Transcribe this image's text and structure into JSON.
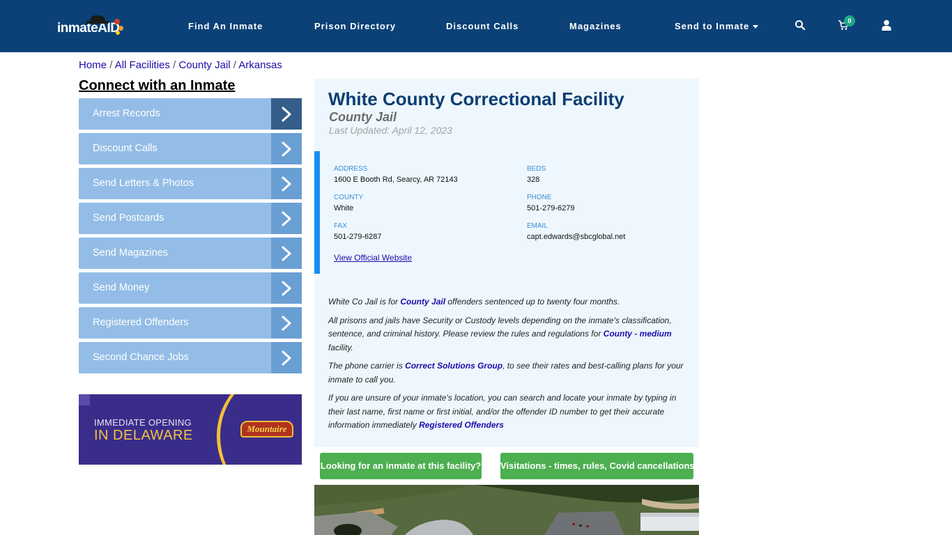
{
  "navbar": {
    "logo_text": "inmateAID",
    "items": [
      {
        "label": "Find An Inmate"
      },
      {
        "label": "Prison Directory"
      },
      {
        "label": "Discount Calls"
      },
      {
        "label": "Magazines"
      },
      {
        "label": "Send to Inmate",
        "has_dropdown": true
      }
    ],
    "icons": [
      "search-icon",
      "cart-icon",
      "user-icon"
    ],
    "cart_count": "0",
    "bg_color": "#0b4177"
  },
  "breadcrumb": [
    {
      "label": "Home"
    },
    {
      "label": "All Facilities"
    },
    {
      "label": "County Jail"
    },
    {
      "label": "Arkansas"
    }
  ],
  "breadcrumb_separator": "/",
  "sidebar": {
    "title": "Connect with an Inmate",
    "items": [
      {
        "label": "Arrest Records",
        "active": true
      },
      {
        "label": "Discount Calls"
      },
      {
        "label": "Send Letters & Photos"
      },
      {
        "label": "Send Postcards"
      },
      {
        "label": "Send Magazines"
      },
      {
        "label": "Send Money"
      },
      {
        "label": "Registered Offenders"
      },
      {
        "label": "Second Chance Jobs"
      }
    ]
  },
  "ad": {
    "line1": "IMMEDIATE OPENING",
    "line2": "IN DELAWARE",
    "brand": "Mountaire"
  },
  "facility": {
    "name": "White County Correctional Facility",
    "type": "County Jail",
    "last_updated": "Last Updated: April 12, 2023",
    "fields": {
      "address": {
        "label": "ADDRESS",
        "value": "1600 E Booth Rd, Searcy, AR 72143"
      },
      "beds": {
        "label": "BEDS",
        "value": "328"
      },
      "county": {
        "label": "COUNTY",
        "value": "White"
      },
      "phone": {
        "label": "PHONE",
        "value": "501-279-6279"
      },
      "fax": {
        "label": "FAX",
        "value": "501-279-6287"
      },
      "email": {
        "label": "EMAIL",
        "value": "capt.edwards@sbcglobal.net"
      }
    },
    "website_link": "View Official Website"
  },
  "description": {
    "p1": {
      "before": "White Co Jail is for ",
      "link": "County Jail",
      "after": " offenders sentenced up to twenty four months."
    },
    "p2": {
      "before": "All prisons and jails have Security or Custody levels depending on the inmate's classification, sentence, and criminal history. Please review the rules and regulations for ",
      "link": "County - medium",
      "after": " facility."
    },
    "p3": {
      "before": "The phone carrier is ",
      "link": "Correct Solutions Group",
      "after": ", to see their rates and best-calling plans for your inmate to call you."
    },
    "p4": {
      "before": "If you are unsure of your inmate's location, you can search and locate your inmate by typing in their last name, first name or first initial, and/or the offender ID number to get their accurate information immediately ",
      "link": "Registered Offenders",
      "after": ""
    }
  },
  "buttons": {
    "find_inmate": "Looking for an inmate at this facility?",
    "visitations": "Visitations - times, rules, Covid cancellations"
  },
  "colors": {
    "title": "#0c3e73",
    "card_bg": "#eef7fd",
    "stripe": "#1a8cf0",
    "green_button": "#4caf50",
    "sidebar_item": "#93bde6",
    "sidebar_arrow": "#6a9fd4",
    "sidebar_arrow_active": "#355d89"
  }
}
